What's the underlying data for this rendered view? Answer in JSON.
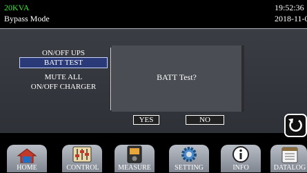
{
  "status": {
    "power_rating": "20KVA",
    "mode": "Bypass Mode",
    "time": "19:52:36",
    "date": "2018-11-0"
  },
  "menu": {
    "items": [
      "ON/OFF UPS",
      "BATT TEST",
      "MUTE ALL",
      "ON/OFF CHARGER"
    ],
    "selected_index": 1
  },
  "dialog": {
    "message": "BATT Test?",
    "yes_label": "YES",
    "no_label": "NO"
  },
  "nav": {
    "tabs": [
      {
        "label": "HOME",
        "icon": "home-icon"
      },
      {
        "label": "CONTROL",
        "icon": "sliders-icon"
      },
      {
        "label": "MEASURE",
        "icon": "meter-icon"
      },
      {
        "label": "SETTING",
        "icon": "gear-icon"
      },
      {
        "label": "INFO",
        "icon": "info-icon"
      },
      {
        "label": "DATALOG",
        "icon": "calendar-icon"
      }
    ]
  },
  "colors": {
    "power_rating": "#39e639",
    "selection": "#2a3a78"
  }
}
